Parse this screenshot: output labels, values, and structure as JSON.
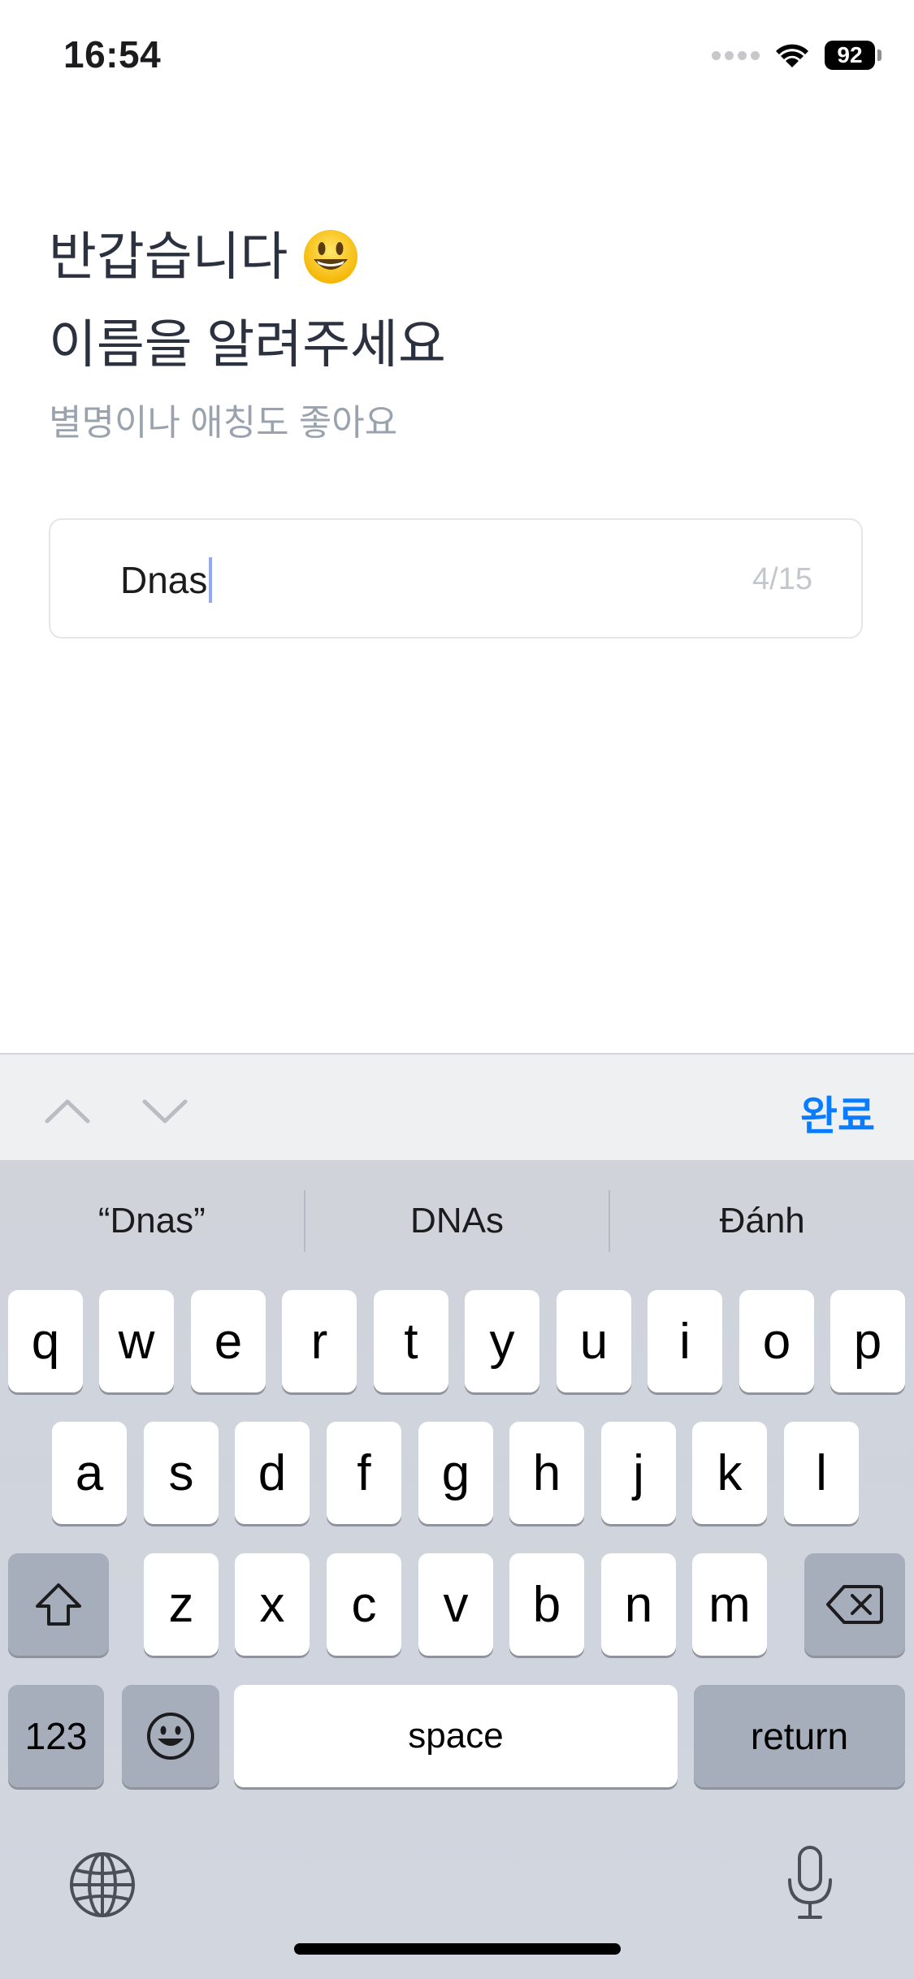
{
  "status_bar": {
    "time": "16:54",
    "battery": "92"
  },
  "header": {
    "line1": "반갑습니다",
    "line2": "이름을 알려주세요",
    "subtitle": "별명이나 애칭도 좋아요"
  },
  "name_input": {
    "value": "Dnas",
    "char_count": "4/15"
  },
  "accessory": {
    "done_label": "완료"
  },
  "keyboard": {
    "suggestions": [
      "“Dnas”",
      "DNAs",
      "Đánh"
    ],
    "row1": [
      "q",
      "w",
      "e",
      "r",
      "t",
      "y",
      "u",
      "i",
      "o",
      "p"
    ],
    "row2": [
      "a",
      "s",
      "d",
      "f",
      "g",
      "h",
      "j",
      "k",
      "l"
    ],
    "row3": [
      "z",
      "x",
      "c",
      "v",
      "b",
      "n",
      "m"
    ],
    "numbers_label": "123",
    "space_label": "space",
    "return_label": "return"
  },
  "colors": {
    "accent": "#0a7cff",
    "headline": "#2c3140",
    "subtitle": "#9aa3ad"
  }
}
